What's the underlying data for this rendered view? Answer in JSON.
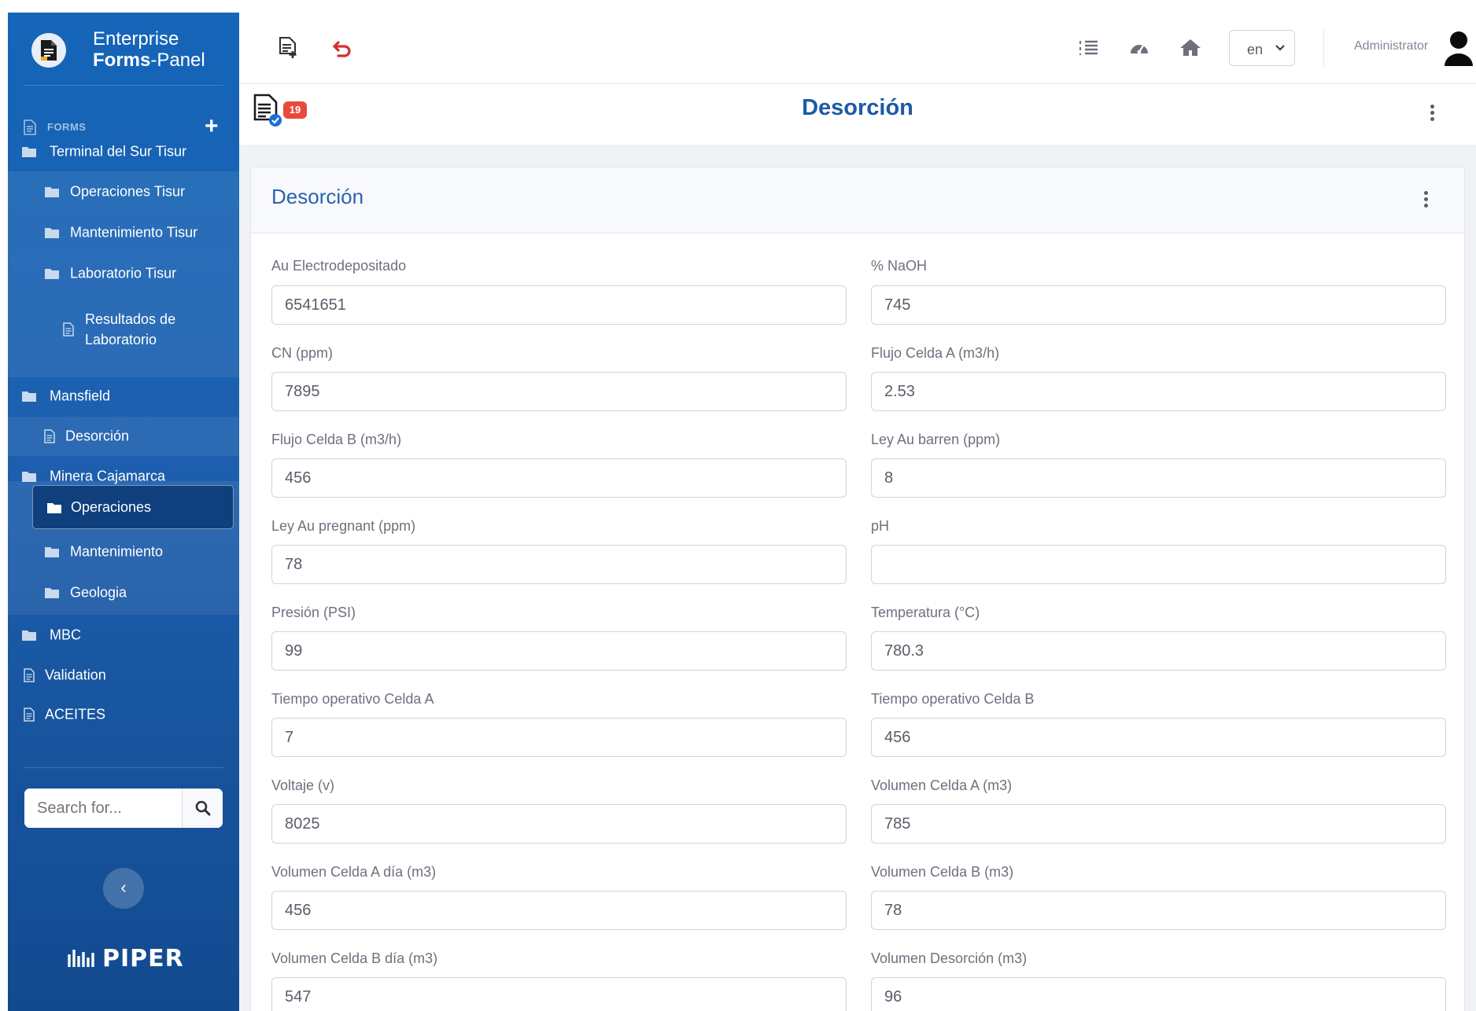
{
  "brand": {
    "line1": "Enterprise",
    "line2_bold": "Forms",
    "line2_rest": "-Panel"
  },
  "sidebar": {
    "header": "FORMS",
    "add_label": "+",
    "items": [
      {
        "label": "Terminal del Sur Tisur"
      },
      {
        "label": "Operaciones Tisur"
      },
      {
        "label": "Mantenimiento Tisur"
      },
      {
        "label": "Laboratorio Tisur"
      },
      {
        "label": "Resultados de",
        "label2": "Laboratorio"
      },
      {
        "label": "Mansfield"
      },
      {
        "label": "Desorción"
      },
      {
        "label": "Minera Cajamarca"
      },
      {
        "label": "Operaciones"
      },
      {
        "label": "Mantenimiento"
      },
      {
        "label": "Geologia"
      },
      {
        "label": "MBC"
      },
      {
        "label": "Validation"
      },
      {
        "label": "ACEITES"
      }
    ],
    "search_placeholder": "Search for...",
    "collapse_label": "‹",
    "footer_logo": "PIPER"
  },
  "topbar": {
    "language": "en",
    "user_name": "Administrator"
  },
  "title_bar": {
    "badge_count": "19",
    "title": "Desorción"
  },
  "card": {
    "title": "Desorción",
    "fields": [
      {
        "label": "Au Electrodepositado",
        "value": "6541651"
      },
      {
        "label": "% NaOH",
        "value": "745"
      },
      {
        "label": "CN (ppm)",
        "value": "7895"
      },
      {
        "label": "Flujo Celda A (m3/h)",
        "value": "2.53"
      },
      {
        "label": "Flujo Celda B (m3/h)",
        "value": "456"
      },
      {
        "label": "Ley Au barren (ppm)",
        "value": "8"
      },
      {
        "label": "Ley Au pregnant (ppm)",
        "value": "78"
      },
      {
        "label": "pH",
        "value": ""
      },
      {
        "label": "Presión (PSI)",
        "value": "99"
      },
      {
        "label": "Temperatura (°C)",
        "value": "780.3"
      },
      {
        "label": "Tiempo operativo Celda A",
        "value": "7"
      },
      {
        "label": "Tiempo operativo Celda B",
        "value": "456"
      },
      {
        "label": "Voltaje (v)",
        "value": "8025"
      },
      {
        "label": "Volumen Celda A (m3)",
        "value": "785"
      },
      {
        "label": "Volumen Celda A día (m3)",
        "value": "456"
      },
      {
        "label": "Volumen Celda B (m3)",
        "value": "78"
      },
      {
        "label": "Volumen Celda B día (m3)",
        "value": "547"
      },
      {
        "label": "Volumen Desorción (m3)",
        "value": "96"
      }
    ]
  },
  "colors": {
    "sidebar": "#1565b8",
    "title": "#1c5aa7",
    "badge": "#e74a3b",
    "undo": "#d0312d"
  },
  "icons": [
    "document-icon",
    "folder-icon",
    "plus-icon",
    "search-icon",
    "new-document-icon",
    "undo-icon",
    "list-icon",
    "dashboard-icon",
    "home-icon",
    "chevron-down-icon",
    "user-icon",
    "kebab-menu-icon",
    "piper-logo-icon"
  ]
}
